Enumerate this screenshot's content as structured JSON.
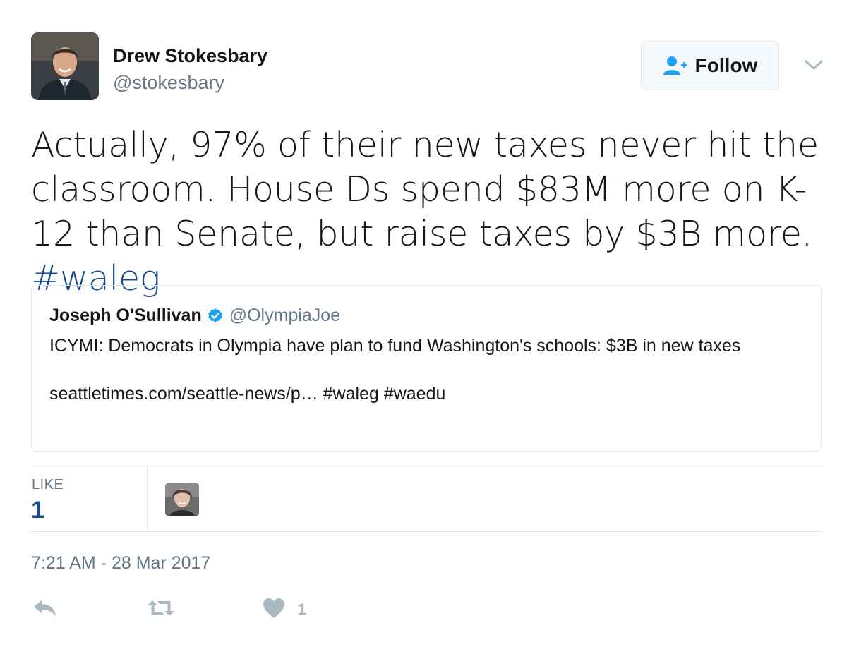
{
  "author": {
    "name": "Drew Stokesbary",
    "handle": "@stokesbary"
  },
  "follow_button": {
    "label": "Follow",
    "icon": "add-user-icon"
  },
  "menu": {
    "icon": "chevron-down-icon"
  },
  "tweet": {
    "text": "Actually, 97% of their new taxes never hit the classroom. House Ds spend $83M more on K-12 than Senate, but raise taxes by $3B more. ",
    "hashtag": "#waleg"
  },
  "quoted_tweet": {
    "name": "Joseph O'Sullivan",
    "verified_icon": "verified-badge-icon",
    "handle": "@OlympiaJoe",
    "text": "ICYMI: Democrats in Olympia have plan to fund Washington's schools: $3B in new taxes",
    "link_line": "seattletimes.com/seattle-news/p… #waleg #waedu"
  },
  "stats": {
    "like_label": "LIKE",
    "like_count": "1"
  },
  "timestamp": "7:21 AM - 28 Mar 2017",
  "actions": {
    "reply_icon": "reply-icon",
    "retweet_icon": "retweet-icon",
    "like_icon": "heart-icon",
    "like_count": "1"
  },
  "colors": {
    "link": "#1b4b8d",
    "muted": "#657786",
    "action_gray": "#aab8c2",
    "verified_blue": "#1da1f2",
    "follow_icon_blue": "#1da1f2"
  }
}
